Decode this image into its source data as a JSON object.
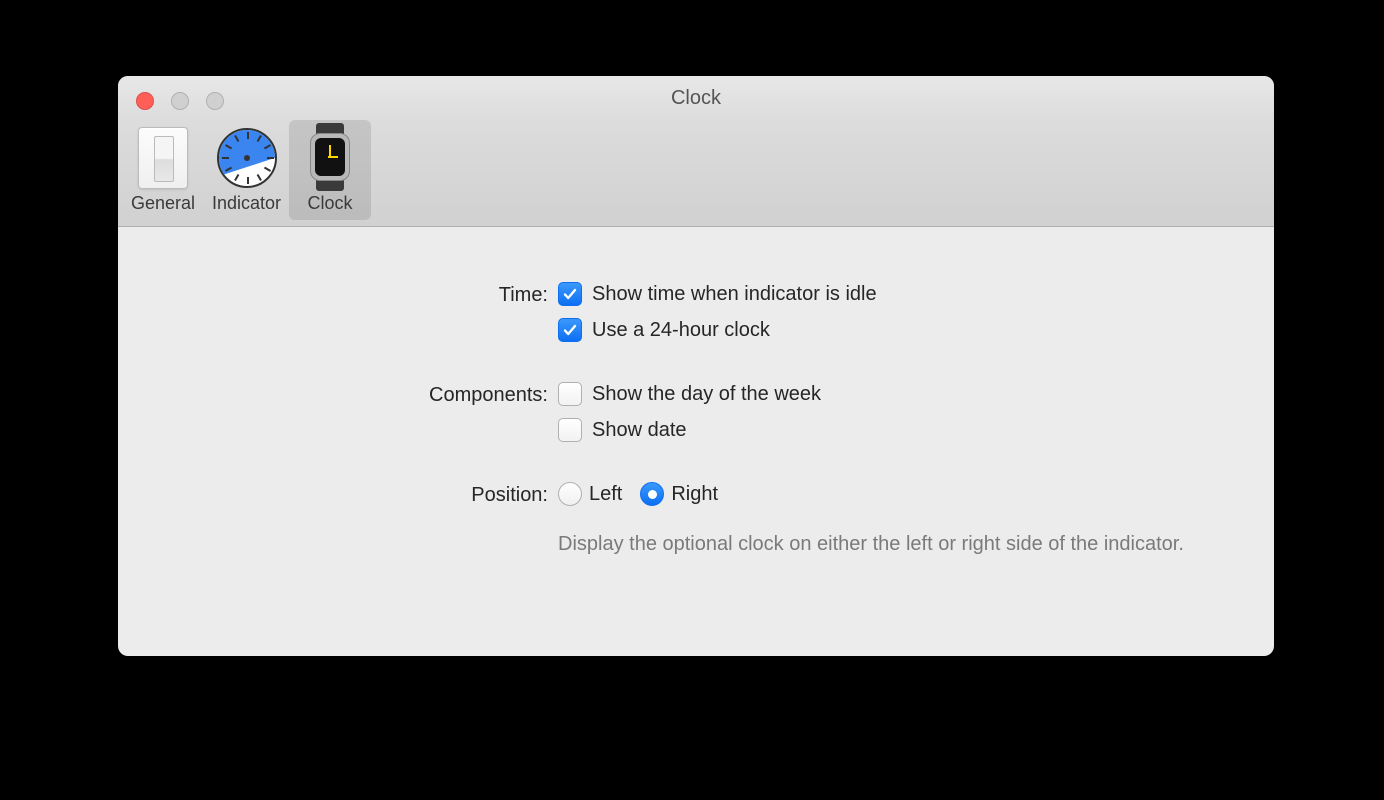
{
  "window": {
    "title": "Clock"
  },
  "toolbar": {
    "items": [
      {
        "label": "General"
      },
      {
        "label": "Indicator"
      },
      {
        "label": "Clock"
      }
    ]
  },
  "sections": {
    "time": {
      "label": "Time:",
      "show_time_label": "Show time when indicator is idle",
      "use_24h_label": "Use a 24-hour clock"
    },
    "components": {
      "label": "Components:",
      "show_day_label": "Show the day of the week",
      "show_date_label": "Show date"
    },
    "position": {
      "label": "Position:",
      "left_label": "Left",
      "right_label": "Right",
      "help_text": "Display the optional clock on either the left or right side of the indicator."
    }
  }
}
